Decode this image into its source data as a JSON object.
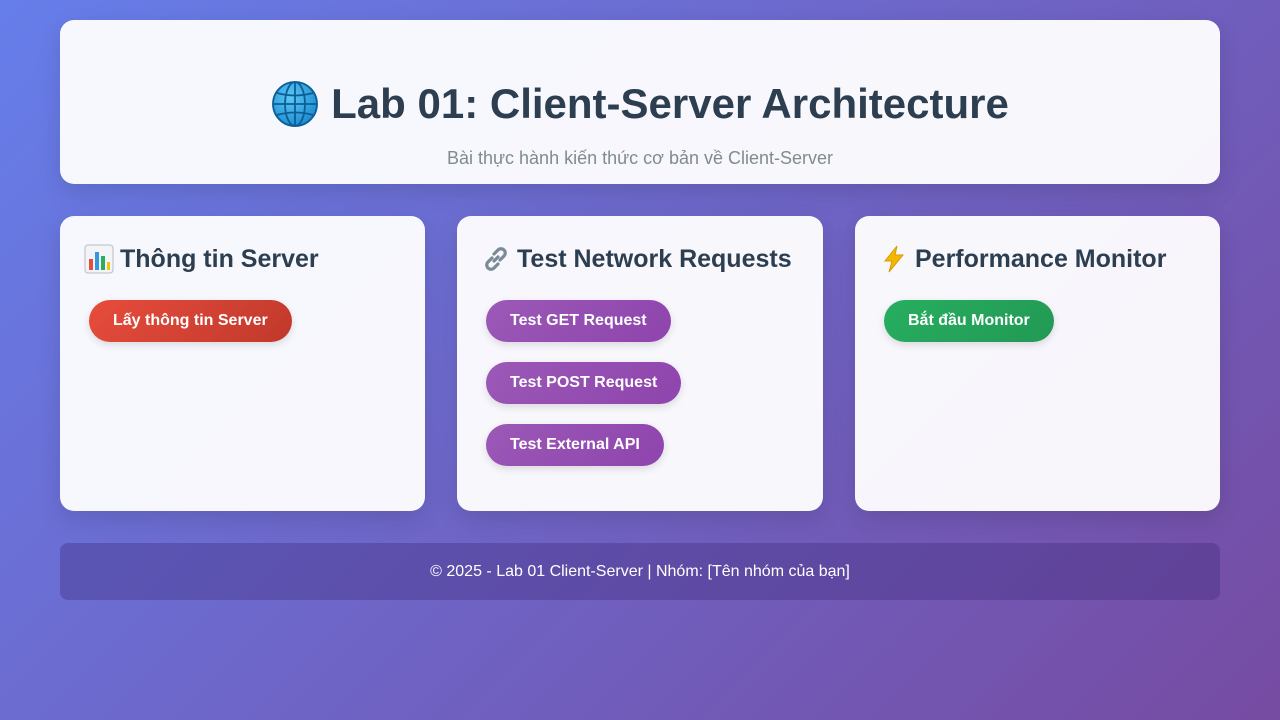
{
  "header": {
    "title": "Lab 01: Client-Server Architecture",
    "subtitle": "Bài thực hành kiến thức cơ bản về Client-Server",
    "icon": "globe-icon"
  },
  "cards": {
    "server_info": {
      "icon": "bar-chart-icon",
      "title": "Thông tin Server",
      "button_label": "Lấy thông tin Server"
    },
    "network": {
      "icon": "link-icon",
      "title": "Test Network Requests",
      "get_label": "Test GET Request",
      "post_label": "Test POST Request",
      "external_label": "Test External API"
    },
    "performance": {
      "icon": "lightning-icon",
      "title": "Performance Monitor",
      "button_label": "Bắt đầu Monitor"
    }
  },
  "footer": {
    "text": "© 2025 - Lab 01 Client-Server | Nhóm: [Tên nhóm của bạn]"
  },
  "colors": {
    "bg_start": "#667eea",
    "bg_end": "#764ba2",
    "red": "#e74c3c",
    "purple": "#9b59b6",
    "green": "#27ae60",
    "text_dark": "#2c3e50"
  }
}
